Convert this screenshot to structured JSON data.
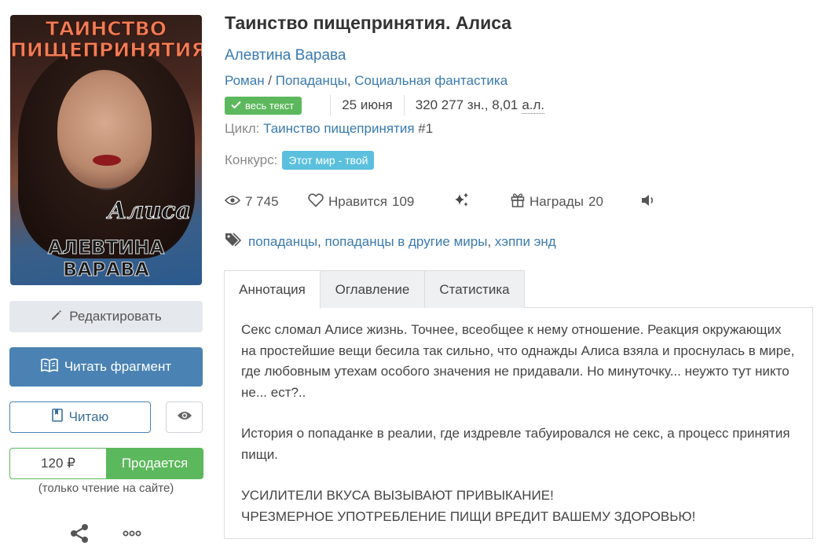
{
  "book": {
    "title": "Таинство пищепринятия. Алиса",
    "author": "Алевтина Варава",
    "genres": [
      "Роман",
      "Попаданцы",
      "Социальная фантастика"
    ],
    "genre_sep_1": " / ",
    "genre_sep_2": ", ",
    "status_badge": "весь текст",
    "date": "25 июня",
    "size": "320 277 зн., 8,01",
    "size_unit": "а.л.",
    "cycle_label": "Цикл:",
    "cycle_name": "Таинство пищепринятия",
    "cycle_number": "#1",
    "contest_label": "Конкурс:",
    "contest_name": "Этот мир - твой"
  },
  "cover": {
    "title": "ТАИНСТВО ПИЩЕПРИНЯТИЯ",
    "subtitle": "Алиса",
    "author": "АЛЕВТИНА ВАРАВА"
  },
  "stats": {
    "views": "7 745",
    "likes_label": "Нравится",
    "likes": "109",
    "awards_label": "Награды",
    "awards": "20"
  },
  "tags": [
    "попаданцы",
    "попаданцы в другие миры",
    "хэппи энд"
  ],
  "sidebar": {
    "edit_label": "Редактировать",
    "read_fragment_label": "Читать фрагмент",
    "reading_label": "Читаю",
    "price": "120 ₽",
    "sell_label": "Продается",
    "price_note": "(только чтение на сайте)"
  },
  "tabs": [
    {
      "label": "Аннотация",
      "active": true
    },
    {
      "label": "Оглавление",
      "active": false
    },
    {
      "label": "Статистика",
      "active": false
    }
  ],
  "annotation": {
    "p1": "Секс сломал Алисе жизнь. Точнее, всеобщее к нему отношение. Реакция окружающих на простейшие вещи бесила так сильно, что однажды Алиса взяла и проснулась в мире, где любовным утехам особого значения не придавали. Но минуточку... неужто тут никто не... ест?..",
    "p2": "История о попаданке в реалии, где издревле табуировался не секс, а процесс принятия пищи.",
    "p3a": "УСИЛИТЕЛИ ВКУСА ВЫЗЫВАЮТ ПРИВЫКАНИЕ!",
    "p3b": "ЧРЕЗМЕРНОЕ УПОТРЕБЛЕНИЕ ПИЩИ ВРЕДИТ ВАШЕМУ ЗДОРОВЬЮ!"
  },
  "colors": {
    "link": "#3a7ab0",
    "primary": "#4a82b3",
    "success": "#5cb85c",
    "info": "#5bc0de"
  }
}
